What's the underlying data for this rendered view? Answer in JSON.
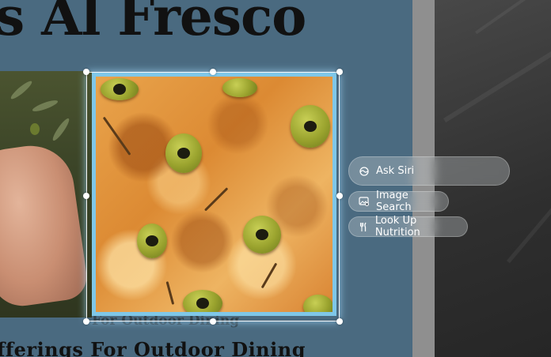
{
  "article": {
    "headline": "s Al Fresco",
    "subhead": "fferings For Outdoor Dining",
    "caption_strip": "For Outdoor Dining"
  },
  "context_menu": {
    "items": [
      {
        "label": "Ask Siri",
        "icon": "siri-icon"
      },
      {
        "label": "Image Search",
        "icon": "image-search-icon"
      },
      {
        "label": "Look Up Nutrition",
        "icon": "fork-knife-icon"
      }
    ]
  },
  "colors": {
    "page_background": "#4a6a80",
    "selection_border": "#7fc7e8"
  }
}
